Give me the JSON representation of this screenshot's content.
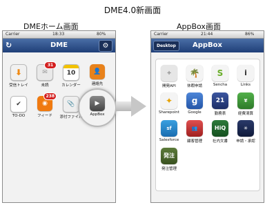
{
  "heading": "DME4.0新画面",
  "left_label": "DMEホーム画面",
  "right_label": "AppBox画面",
  "left_phone": {
    "carrier": "Carrier",
    "time": "18:33",
    "battery": "80%",
    "title": "DME",
    "refresh_icon": "refresh-icon",
    "settings_icon": "gear-icon",
    "tiles": [
      {
        "label": "受信トレイ",
        "badge": ""
      },
      {
        "label": "未読",
        "badge": "31"
      },
      {
        "label": "カレンダー",
        "badge": "",
        "date": "10"
      },
      {
        "label": "連絡先",
        "badge": ""
      },
      {
        "label": "TO-DO",
        "badge": ""
      },
      {
        "label": "フィード",
        "badge": "238"
      },
      {
        "label": "添付ファイル",
        "badge": ""
      },
      {
        "label": "AppBox",
        "badge": ""
      }
    ]
  },
  "right_phone": {
    "carrier": "Carrier",
    "time": "21:44",
    "battery": "86%",
    "back_button": "Desktop",
    "title": "AppBox",
    "apps": [
      {
        "label": "開発API",
        "text": ""
      },
      {
        "label": "休暇申請",
        "text": ""
      },
      {
        "label": "Sencha",
        "text": ""
      },
      {
        "label": "Links",
        "text": "i"
      },
      {
        "label": "Sharepoint",
        "text": ""
      },
      {
        "label": "Google",
        "text": "g"
      },
      {
        "label": "勤務表",
        "text": "21"
      },
      {
        "label": "経費清算",
        "text": ""
      },
      {
        "label": "Salesforce",
        "text": "sf"
      },
      {
        "label": "顧客管理",
        "text": ""
      },
      {
        "label": "社内文書",
        "text": "HiQ"
      },
      {
        "label": "申請・承認",
        "text": ""
      },
      {
        "label": "発注管理",
        "text": "発注"
      }
    ]
  },
  "colors": {
    "navbar": "#2b4c86",
    "badge": "#d32020"
  }
}
